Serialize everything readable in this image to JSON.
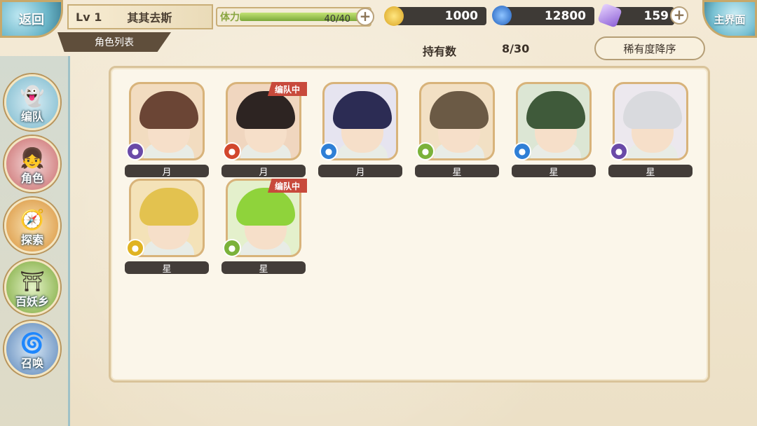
{
  "header": {
    "back_label": "返回",
    "level": "Lv 1",
    "player_name": "其其去斯",
    "tab_label": "角色列表",
    "stamina_label": "体力",
    "stamina_value": "40/40",
    "stamina_fraction": 1.0,
    "gold": "1000",
    "soul": "12800",
    "crystal": "159",
    "home_label": "主界面"
  },
  "summary": {
    "own_label": "持有数",
    "own_count": "8/30",
    "sort_label": "稀有度降序"
  },
  "sidebar": {
    "items": [
      {
        "label": "编队",
        "icon": "ghost-icon"
      },
      {
        "label": "角色",
        "icon": "character-icon"
      },
      {
        "label": "探索",
        "icon": "compass-icon"
      },
      {
        "label": "百妖乡",
        "icon": "village-icon"
      },
      {
        "label": "召唤",
        "icon": "summon-icon"
      }
    ]
  },
  "characters": [
    {
      "rank": "月",
      "element": "dark",
      "in_team": false,
      "team_label": ""
    },
    {
      "rank": "月",
      "element": "fire",
      "in_team": true,
      "team_label": "编队中"
    },
    {
      "rank": "月",
      "element": "water",
      "in_team": false,
      "team_label": ""
    },
    {
      "rank": "星",
      "element": "wind",
      "in_team": false,
      "team_label": ""
    },
    {
      "rank": "星",
      "element": "water",
      "in_team": false,
      "team_label": ""
    },
    {
      "rank": "星",
      "element": "dark",
      "in_team": false,
      "team_label": ""
    },
    {
      "rank": "星",
      "element": "light",
      "in_team": false,
      "team_label": ""
    },
    {
      "rank": "星",
      "element": "wind",
      "in_team": true,
      "team_label": "编队中"
    }
  ],
  "colors": {
    "accent": "#c9ae77",
    "team_tag": "#c84a3c",
    "element_dark": "#6a4aa8",
    "element_fire": "#d2472d",
    "element_water": "#2f7fd6",
    "element_wind": "#7bb23a",
    "element_light": "#e0b321"
  }
}
